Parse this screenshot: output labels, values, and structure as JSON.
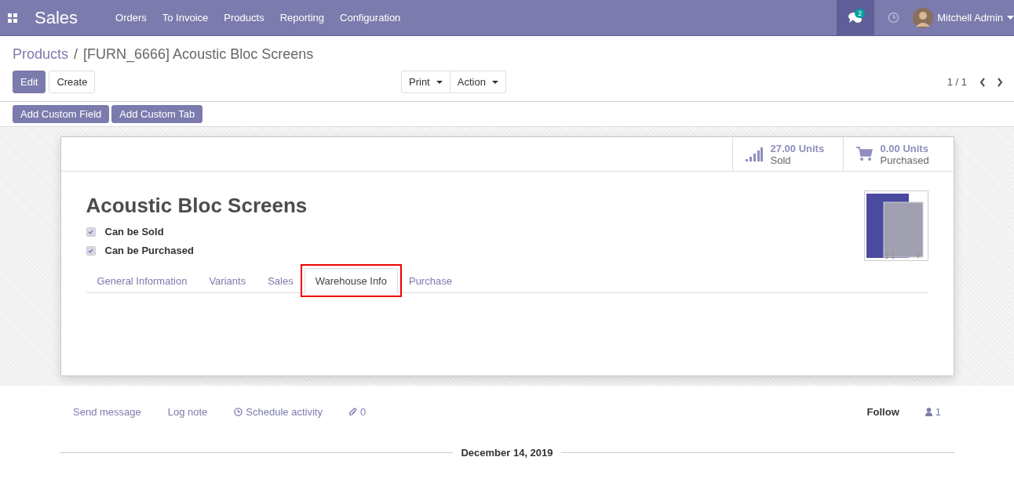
{
  "navbar": {
    "app": "Sales",
    "menu": [
      "Orders",
      "To Invoice",
      "Products",
      "Reporting",
      "Configuration"
    ],
    "messages_badge": "2",
    "user": "Mitchell Admin"
  },
  "breadcrumb": {
    "parent": "Products",
    "separator": "/",
    "current": "[FURN_6666] Acoustic Bloc Screens"
  },
  "buttons": {
    "edit": "Edit",
    "create": "Create",
    "print": "Print",
    "action": "Action"
  },
  "pager": "1 / 1",
  "studio_buttons": [
    "Add Custom Field",
    "Add Custom Tab"
  ],
  "stats": [
    {
      "kind": "chart",
      "value": "27.00 Units",
      "label": "Sold"
    },
    {
      "kind": "cart",
      "value": "0.00 Units",
      "label": "Purchased"
    }
  ],
  "product": {
    "name": "Acoustic Bloc Screens",
    "options": [
      {
        "label": "Can be Sold",
        "checked": true
      },
      {
        "label": "Can be Purchased",
        "checked": true
      }
    ]
  },
  "tabs": [
    {
      "label": "General Information",
      "selected": false,
      "highlighted": false
    },
    {
      "label": "Variants",
      "selected": false,
      "highlighted": false
    },
    {
      "label": "Sales",
      "selected": false,
      "highlighted": false
    },
    {
      "label": "Warehouse Info",
      "selected": true,
      "highlighted": true
    },
    {
      "label": "Purchase",
      "selected": false,
      "highlighted": false
    }
  ],
  "chatter": {
    "send": "Send message",
    "log": "Log note",
    "schedule": "Schedule activity",
    "attachments": "0",
    "follow": "Follow",
    "followers": "1",
    "date": "December 14, 2019"
  }
}
